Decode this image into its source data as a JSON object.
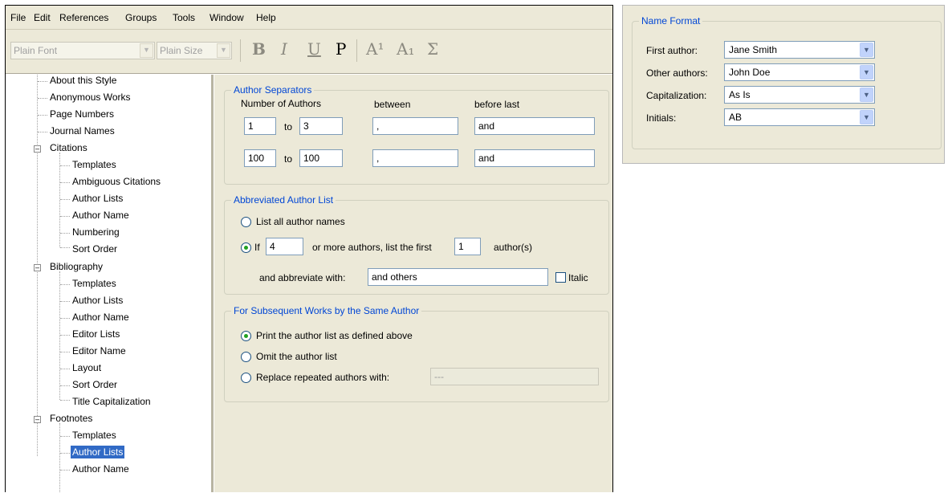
{
  "menu": {
    "file": "File",
    "edit": "Edit",
    "references": "References",
    "groups": "Groups",
    "tools": "Tools",
    "window": "Window",
    "help": "Help"
  },
  "toolbar": {
    "font": "Plain Font",
    "size": "Plain Size",
    "bold": "B",
    "italic": "I",
    "underline": "U",
    "plain": "P",
    "superscript": "A¹",
    "subscript": "A₁",
    "symbol": "Σ"
  },
  "tree": {
    "about": "About this Style",
    "anonymous": "Anonymous Works",
    "page_numbers": "Page Numbers",
    "journal_names": "Journal Names",
    "citations": {
      "label": "Citations",
      "children": [
        "Templates",
        "Ambiguous Citations",
        "Author Lists",
        "Author Name",
        "Numbering",
        "Sort Order"
      ]
    },
    "bibliography": {
      "label": "Bibliography",
      "children": [
        "Templates",
        "Author Lists",
        "Author Name",
        "Editor Lists",
        "Editor Name",
        "Layout",
        "Sort Order",
        "Title Capitalization"
      ]
    },
    "footnotes": {
      "label": "Footnotes",
      "children": [
        "Templates",
        "Author Lists",
        "Author Name"
      ]
    },
    "selected": "Footnotes > Author Lists"
  },
  "author_separators": {
    "title": "Author Separators",
    "col_number": "Number of Authors",
    "col_between": "between",
    "col_before_last": "before last",
    "to": "to",
    "rows": [
      {
        "from": "1",
        "to": "3",
        "between": ",",
        "before_last": "and"
      },
      {
        "from": "100",
        "to": "100",
        "between": ",",
        "before_last": "and"
      }
    ]
  },
  "abbreviated": {
    "title": "Abbreviated Author List",
    "list_all": "List all author names",
    "if_label": "If",
    "if_count": "4",
    "or_more": "or more authors, list the first",
    "first_count": "1",
    "authors_suffix": "author(s)",
    "abbreviate_label": "and abbreviate with:",
    "abbreviate_value": "and others",
    "italic": "Italic",
    "selected": "if"
  },
  "subsequent": {
    "title": "For Subsequent Works by the Same Author",
    "opt1": "Print the author list as defined above",
    "opt2": "Omit the author list",
    "opt3": "Replace repeated authors with:",
    "replace_value": "---",
    "selected": "opt1"
  },
  "name_format": {
    "title": "Name Format",
    "first_author_label": "First author:",
    "first_author": "Jane Smith",
    "other_authors_label": "Other authors:",
    "other_authors": "John Doe",
    "capitalization_label": "Capitalization:",
    "capitalization": "As Is",
    "initials_label": "Initials:",
    "initials": "AB"
  },
  "colors": {
    "selection": "#316ac5",
    "legend": "#0046d5",
    "panel": "#ece9d8"
  }
}
